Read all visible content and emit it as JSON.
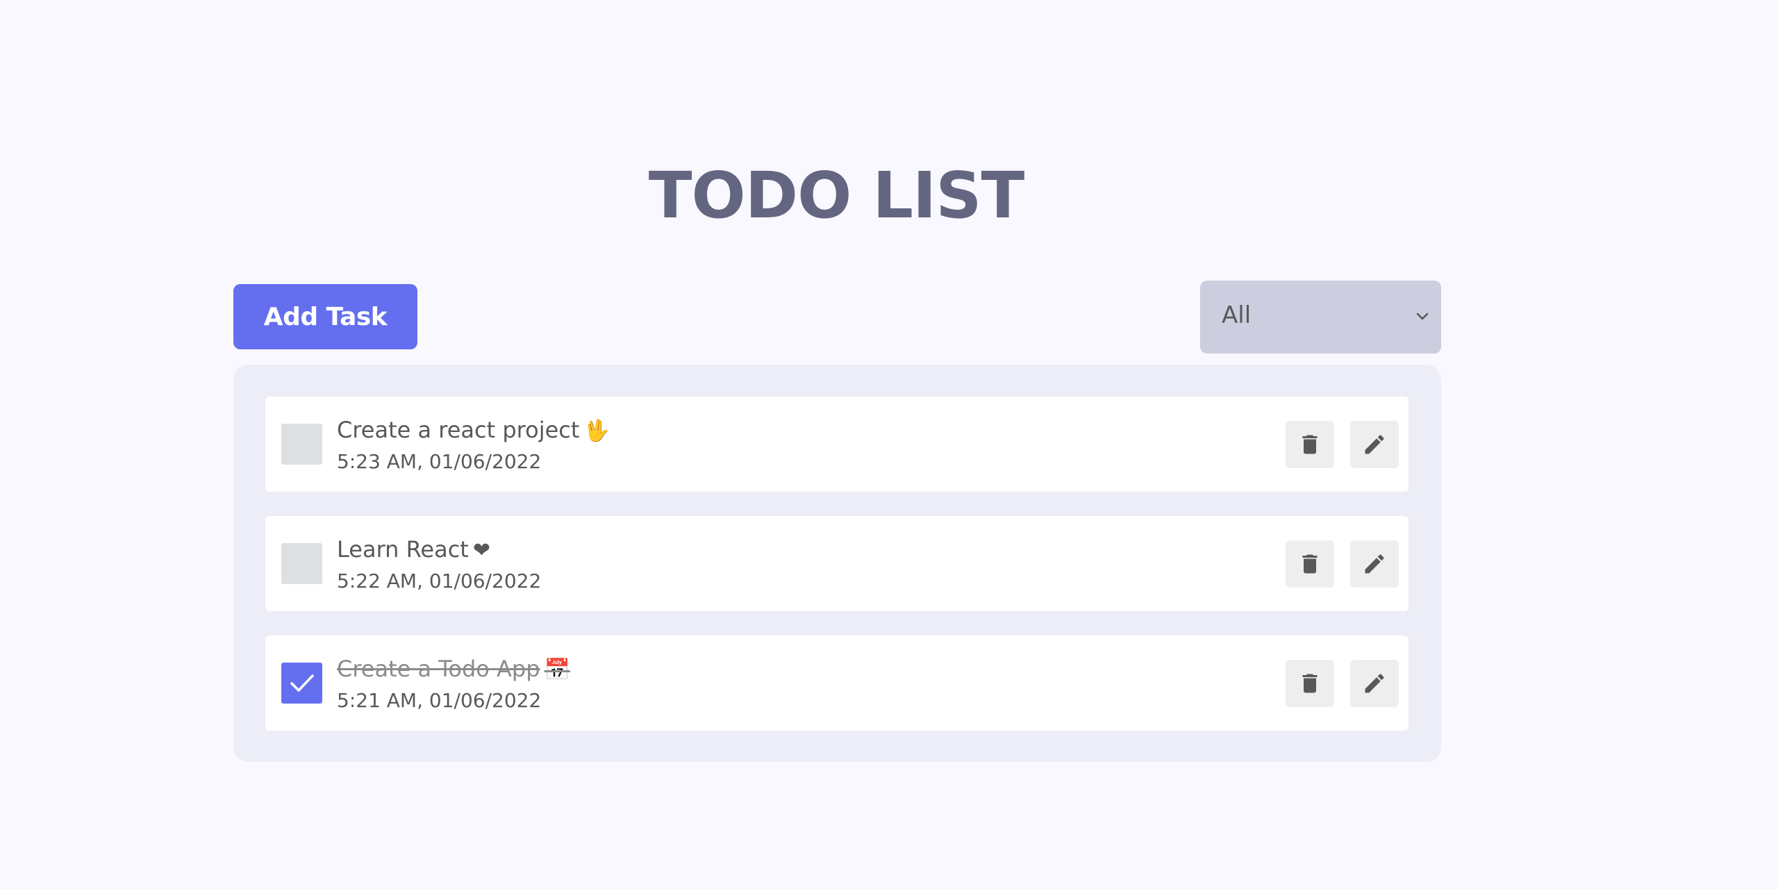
{
  "header": {
    "title": "TODO LIST"
  },
  "toolbar": {
    "add_label": "Add Task",
    "filter_value": "All"
  },
  "tasks": [
    {
      "title": "Create a react project",
      "emoji": "🖖",
      "time": "5:23 AM, 01/06/2022",
      "completed": false
    },
    {
      "title": "Learn React",
      "emoji": "❤",
      "time": "5:22 AM, 01/06/2022",
      "completed": false
    },
    {
      "title": "Create a Todo App",
      "emoji": "📅",
      "time": "5:21 AM, 01/06/2022",
      "completed": true
    }
  ],
  "colors": {
    "accent": "#646ff0",
    "title": "#646681",
    "background": "#f8f8fe",
    "panel": "#ecedf6"
  }
}
